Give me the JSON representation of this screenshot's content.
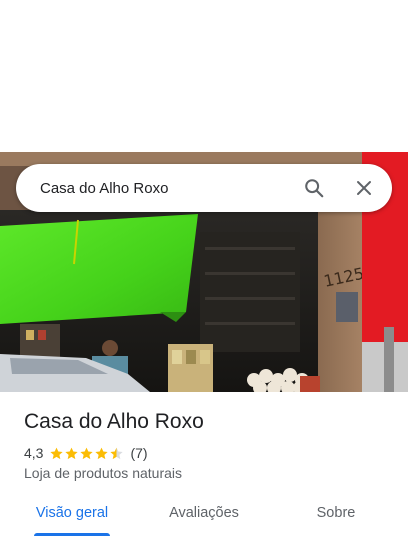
{
  "search": {
    "query": "Casa do Alho Roxo",
    "search_icon": "search-icon",
    "close_icon": "close-icon"
  },
  "photo": {
    "sign_number": "1125"
  },
  "place": {
    "name": "Casa do Alho Roxo",
    "rating_text": "4,3",
    "rating_value": 4.3,
    "rating_max": 5,
    "review_count": "(7)",
    "category": "Loja de produtos naturais"
  },
  "tabs": [
    {
      "label": "Visão geral",
      "active": true
    },
    {
      "label": "Avaliações",
      "active": false
    },
    {
      "label": "Sobre",
      "active": false
    }
  ],
  "colors": {
    "accent": "#1a73e8",
    "star": "#fbbc04",
    "tarp": "#4ddb1c",
    "red_wall": "#e31b23"
  }
}
